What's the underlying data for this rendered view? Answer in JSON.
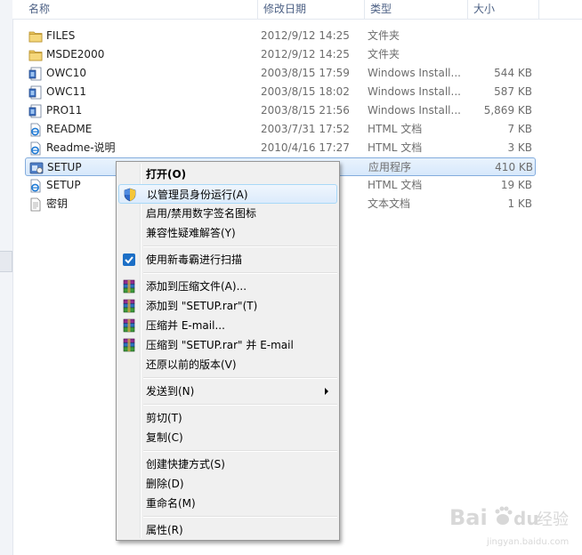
{
  "columns": {
    "name": "名称",
    "date": "修改日期",
    "type": "类型",
    "size": "大小"
  },
  "files": [
    {
      "name": "FILES",
      "date": "2012/9/12 14:25",
      "type": "文件夹",
      "size": "",
      "icon": "folder-icon"
    },
    {
      "name": "MSDE2000",
      "date": "2012/9/12 14:25",
      "type": "文件夹",
      "size": "",
      "icon": "folder-icon"
    },
    {
      "name": "OWC10",
      "date": "2003/8/15 17:59",
      "type": "Windows Install...",
      "size": "544 KB",
      "icon": "installer-icon"
    },
    {
      "name": "OWC11",
      "date": "2003/8/15 18:02",
      "type": "Windows Install...",
      "size": "587 KB",
      "icon": "installer-icon"
    },
    {
      "name": "PRO11",
      "date": "2003/8/15 21:56",
      "type": "Windows Install...",
      "size": "5,869 KB",
      "icon": "installer-icon"
    },
    {
      "name": "README",
      "date": "2003/7/31 17:52",
      "type": "HTML 文档",
      "size": "7 KB",
      "icon": "ie-document-icon"
    },
    {
      "name": "Readme-说明",
      "date": "2010/4/16 17:27",
      "type": "HTML 文档",
      "size": "3 KB",
      "icon": "ie-document-icon"
    },
    {
      "name": "SETUP",
      "date": "",
      "type": "应用程序",
      "size": "410 KB",
      "icon": "setup-exe-icon",
      "selected": true
    },
    {
      "name": "SETUP",
      "date": "",
      "type": "HTML 文档",
      "size": "19 KB",
      "icon": "ie-document-icon"
    },
    {
      "name": "密钥",
      "date": "",
      "type": "文本文档",
      "size": "1 KB",
      "icon": "text-file-icon"
    }
  ],
  "context_menu": [
    {
      "label": "打开(O)",
      "bold": true
    },
    {
      "label": "以管理员身份运行(A)",
      "icon": "uac-shield-icon",
      "hover": true
    },
    {
      "label": "启用/禁用数字签名图标"
    },
    {
      "label": "兼容性疑难解答(Y)"
    },
    {
      "separator": true
    },
    {
      "label": "使用新毒霸进行扫描",
      "icon": "antivirus-icon"
    },
    {
      "separator": true
    },
    {
      "label": "添加到压缩文件(A)...",
      "icon": "winrar-icon"
    },
    {
      "label": "添加到 \"SETUP.rar\"(T)",
      "icon": "winrar-icon"
    },
    {
      "label": "压缩并 E-mail...",
      "icon": "winrar-icon"
    },
    {
      "label": "压缩到 \"SETUP.rar\" 并 E-mail",
      "icon": "winrar-icon"
    },
    {
      "label": "还原以前的版本(V)"
    },
    {
      "separator": true
    },
    {
      "label": "发送到(N)",
      "submenu": true
    },
    {
      "separator": true
    },
    {
      "label": "剪切(T)"
    },
    {
      "label": "复制(C)"
    },
    {
      "separator": true
    },
    {
      "label": "创建快捷方式(S)"
    },
    {
      "label": "删除(D)"
    },
    {
      "label": "重命名(M)"
    },
    {
      "separator": true
    },
    {
      "label": "属性(R)"
    }
  ],
  "watermark": {
    "brand": "Bai",
    "brand2": "du",
    "product": "经验",
    "url": "jingyan.baidu.com"
  },
  "colors": {
    "selection": "#d7e8fb",
    "header_text": "#4d6185",
    "menu_bg": "#f0f0f0"
  }
}
